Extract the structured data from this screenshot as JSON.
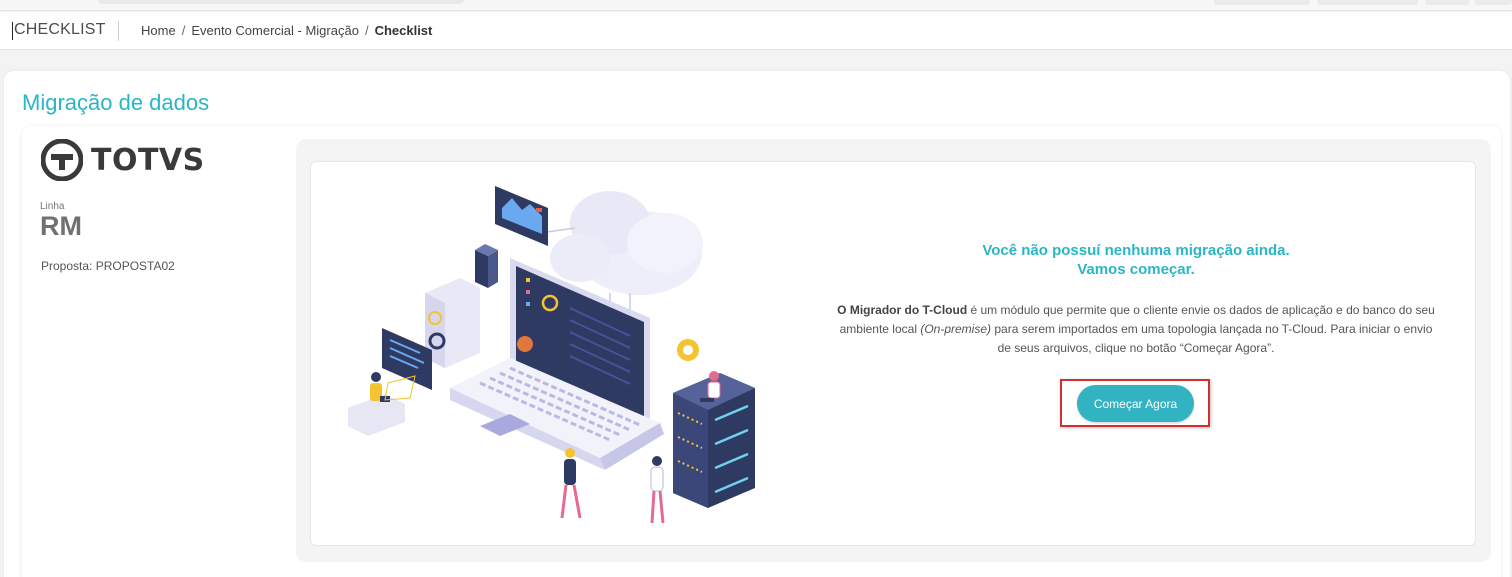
{
  "header": {
    "section_title": "CHECKLIST",
    "breadcrumb": [
      "Home",
      "Evento Comercial - Migração",
      "Checklist"
    ],
    "breadcrumb_separator": "/"
  },
  "page": {
    "heading": "Migração de dados"
  },
  "product": {
    "logo_text": "TOTVS",
    "linha_label": "Linha",
    "linha_value": "RM",
    "proposta": "Proposta: PROPOSTA02"
  },
  "message": {
    "title_line1": "Você não possuí nenhuma migração ainda.",
    "title_line2": "Vamos começar.",
    "body_bold": "O Migrador do T-Cloud",
    "body_part1": " é um módulo que permite que o cliente envie os dados de aplicação e do banco do seu ambiente local ",
    "body_italic": "(On-premise)",
    "body_part2": " para serem importados em uma topologia lançada no T-Cloud. Para iniciar o envio de seus arquivos, clique no botão “Começar Agora”."
  },
  "actions": {
    "start_label": "Começar Agora"
  },
  "colors": {
    "accent": "#29b6c5",
    "button": "#32b3c1",
    "highlight": "#d32f2f",
    "illustration_dark": "#2f3a63",
    "illustration_light": "#e8e8f7"
  },
  "icons": {
    "logo": "totvs-logo-icon",
    "illustration": "cloud-migration-illustration"
  }
}
